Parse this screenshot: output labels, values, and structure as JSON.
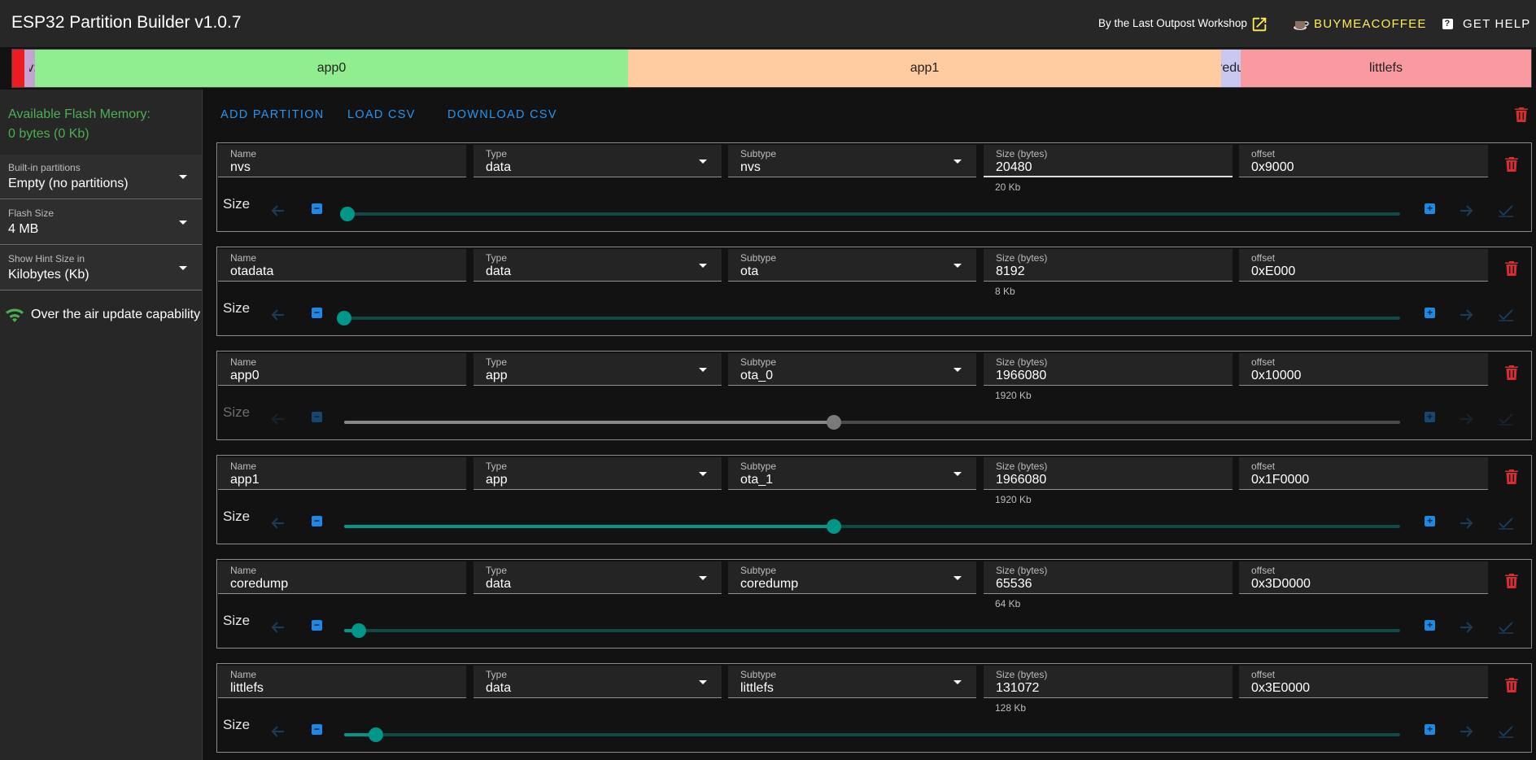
{
  "app": {
    "title": "ESP32 Partition Builder v1.0.7",
    "byline": "By the Last Outpost Workshop",
    "coffee_label": "BUYMEACOFFEE",
    "help_label": "GET HELP"
  },
  "partition_map": [
    {
      "label": "",
      "fraction": 0.0078,
      "color": "#ed1c24"
    },
    {
      "label": "",
      "fraction": 0.0033,
      "color": "#c7a3d6"
    },
    {
      "label": "v:",
      "fraction": 0.0039,
      "color": "#c3a3cf"
    },
    {
      "label": "app0",
      "fraction": 0.3906,
      "color": "#90ee90"
    },
    {
      "label": "app1",
      "fraction": 0.3906,
      "color": "#ffcba0"
    },
    {
      "label": "redu",
      "fraction": 0.013,
      "color": "#c9c8f2"
    },
    {
      "label": "littlefs",
      "fraction": 0.026,
      "color": "#f99aa1"
    }
  ],
  "sidebar": {
    "available_label": "Available Flash Memory:",
    "available_value": "0 bytes (0 Kb)",
    "builtin": {
      "label": "Built-in partitions",
      "value": "Empty (no partitions)"
    },
    "flash_size": {
      "label": "Flash Size",
      "value": "4 MB"
    },
    "hint_size": {
      "label": "Show Hint Size in",
      "value": "Kilobytes (Kb)"
    },
    "ota_label": "Over the air update capability"
  },
  "toolbar": {
    "add": "ADD PARTITION",
    "load": "LOAD CSV",
    "download": "DOWNLOAD CSV"
  },
  "labels": {
    "name": "Name",
    "type": "Type",
    "subtype": "Subtype",
    "size_bytes": "Size (bytes)",
    "offset": "offset",
    "size": "Size"
  },
  "partitions": [
    {
      "name": "nvs",
      "type": "data",
      "subtype": "nvs",
      "size": "20480",
      "hint": "20 Kb",
      "offset": "0x9000",
      "slider_level": 0.003,
      "enabled": true
    },
    {
      "name": "otadata",
      "type": "data",
      "subtype": "ota",
      "size": "8192",
      "hint": "8 Kb",
      "offset": "0xE000",
      "slider_level": 0.0,
      "enabled": true
    },
    {
      "name": "app0",
      "type": "app",
      "subtype": "ota_0",
      "size": "1966080",
      "hint": "1920 Kb",
      "offset": "0x10000",
      "slider_level": 0.464,
      "enabled": false
    },
    {
      "name": "app1",
      "type": "app",
      "subtype": "ota_1",
      "size": "1966080",
      "hint": "1920 Kb",
      "offset": "0x1F0000",
      "slider_level": 0.464,
      "enabled": true
    },
    {
      "name": "coredump",
      "type": "data",
      "subtype": "coredump",
      "size": "65536",
      "hint": "64 Kb",
      "offset": "0x3D0000",
      "slider_level": 0.014,
      "enabled": true
    },
    {
      "name": "littlefs",
      "type": "data",
      "subtype": "littlefs",
      "size": "131072",
      "hint": "128 Kb",
      "offset": "0x3E0000",
      "slider_level": 0.03,
      "enabled": true
    }
  ]
}
